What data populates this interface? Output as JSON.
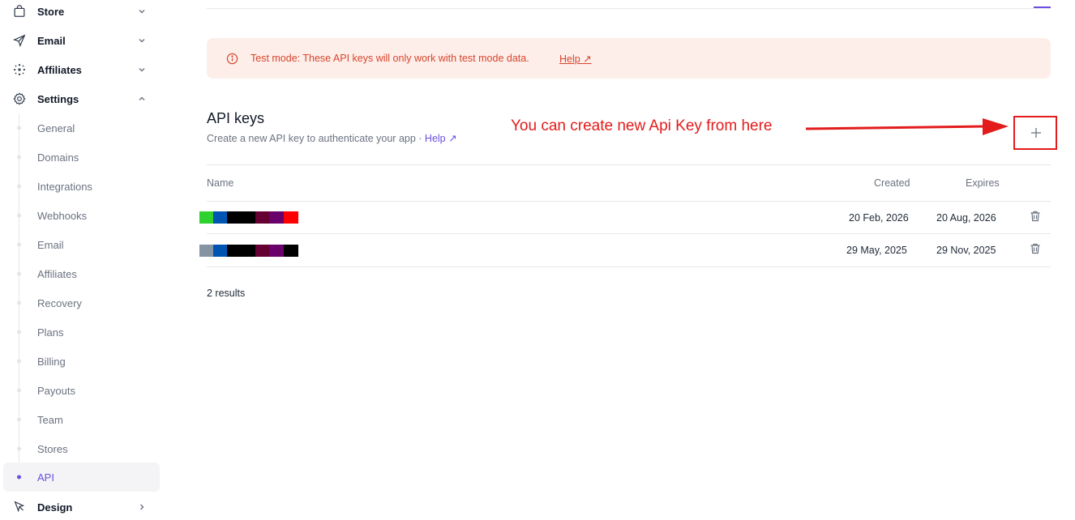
{
  "sidebar": {
    "top": [
      {
        "label": "Store",
        "icon": "bag-icon",
        "chevron": "down"
      },
      {
        "label": "Email",
        "icon": "send-icon",
        "chevron": "down"
      },
      {
        "label": "Affiliates",
        "icon": "network-icon",
        "chevron": "down"
      },
      {
        "label": "Settings",
        "icon": "gear-icon",
        "chevron": "up"
      }
    ],
    "settings_items": [
      "General",
      "Domains",
      "Integrations",
      "Webhooks",
      "Email",
      "Affiliates",
      "Recovery",
      "Plans",
      "Billing",
      "Payouts",
      "Team",
      "Stores",
      "API"
    ],
    "active_item": "API",
    "bottom": {
      "label": "Design",
      "icon": "cursor-icon",
      "chevron": "right"
    }
  },
  "banner": {
    "text": "Test mode: These API keys will only work with test mode data.",
    "help": "Help ↗"
  },
  "api": {
    "title": "API keys",
    "description": "Create a new API key to authenticate your app · ",
    "help": "Help ↗"
  },
  "annotation": {
    "text": "You can create new Api Key from here",
    "color": "#e31b1b"
  },
  "table": {
    "headers": {
      "name": "Name",
      "created": "Created",
      "expires": "Expires"
    },
    "rows": [
      {
        "created": "20 Feb, 2026",
        "expires": "20 Aug, 2026",
        "redaction_colors": [
          "#2ed12e",
          "#0055b3",
          "#000000",
          "#000000",
          "#660033",
          "#6a006a",
          "#ff0000"
        ]
      },
      {
        "created": "29 May, 2025",
        "expires": "29 Nov, 2025",
        "redaction_colors": [
          "#8494a3",
          "#0055b3",
          "#000000",
          "#000000",
          "#660033",
          "#6a006a",
          "#000000"
        ]
      }
    ],
    "results": "2 results"
  },
  "colors": {
    "accent": "#6d4fe0",
    "banner_bg": "#fdeeea",
    "banner_text": "#d7462c"
  }
}
